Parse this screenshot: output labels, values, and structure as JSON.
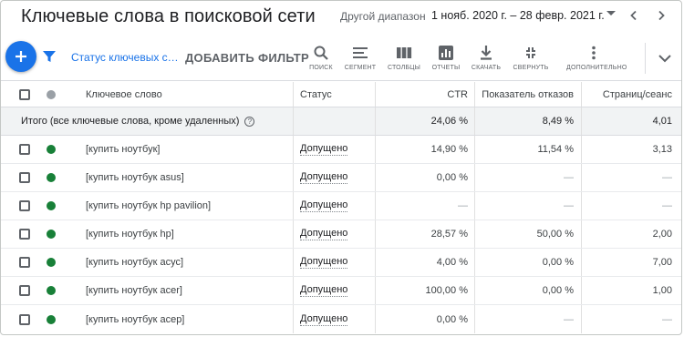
{
  "header": {
    "title": "Ключевые слова в поисковой сети",
    "range_label": "Другой диапазон",
    "range_value": "1 нояб. 2020 г. – 28 февр. 2021 г."
  },
  "toolbar": {
    "status_chip": "Статус ключевых с…",
    "add_filter": "ДОБАВИТЬ ФИЛЬТР",
    "search": "ПОИСК",
    "segment": "СЕГМЕНТ",
    "columns": "СТОЛБЦЫ",
    "reports": "ОТЧЕТЫ",
    "download": "СКАЧАТЬ",
    "collapse": "СВЕРНУТЬ",
    "more": "ДОПОЛНИТЕЛЬНО"
  },
  "table": {
    "headers": {
      "keyword": "Ключевое слово",
      "status": "Статус",
      "ctr": "CTR",
      "bounce": "Показатель отказов",
      "pages": "Страниц/сеанс"
    },
    "total": {
      "label": "Итого (все ключевые слова, кроме удаленных)",
      "help": "?",
      "ctr": "24,06 %",
      "bounce": "8,49 %",
      "pages": "4,01"
    },
    "rows": [
      {
        "keyword": "[купить ноутбук]",
        "status": "Допущено",
        "ctr": "14,90 %",
        "bounce": "11,54 %",
        "pages": "3,13"
      },
      {
        "keyword": "[купить ноутбук asus]",
        "status": "Допущено",
        "ctr": "0,00 %",
        "bounce": "—",
        "pages": "—"
      },
      {
        "keyword": "[купить ноутбук hp pavilion]",
        "status": "Допущено",
        "ctr": "—",
        "bounce": "—",
        "pages": "—"
      },
      {
        "keyword": "[купить ноутбук hp]",
        "status": "Допущено",
        "ctr": "28,57 %",
        "bounce": "50,00 %",
        "pages": "2,00"
      },
      {
        "keyword": "[купить ноутбук асус]",
        "status": "Допущено",
        "ctr": "4,00 %",
        "bounce": "0,00 %",
        "pages": "7,00"
      },
      {
        "keyword": "[купить ноутбук acer]",
        "status": "Допущено",
        "ctr": "100,00 %",
        "bounce": "0,00 %",
        "pages": "1,00"
      },
      {
        "keyword": "[купить ноутбук асер]",
        "status": "Допущено",
        "ctr": "0,00 %",
        "bounce": "—",
        "pages": "—"
      }
    ]
  },
  "colors": {
    "accent": "#1a73e8",
    "status_green": "#188038",
    "status_grey": "#9aa0a6",
    "total_row_bg": "#f1f3f4"
  },
  "icons": {
    "fab": "plus-icon",
    "filter": "filter-icon",
    "search": "search-icon",
    "segment": "segment-icon",
    "columns": "columns-icon",
    "reports": "reports-icon",
    "download": "download-icon",
    "collapse": "collapse-icon",
    "more": "more-vert-icon",
    "expand": "chevron-down-icon",
    "prev": "chevron-left-icon",
    "next": "chevron-right-icon"
  }
}
